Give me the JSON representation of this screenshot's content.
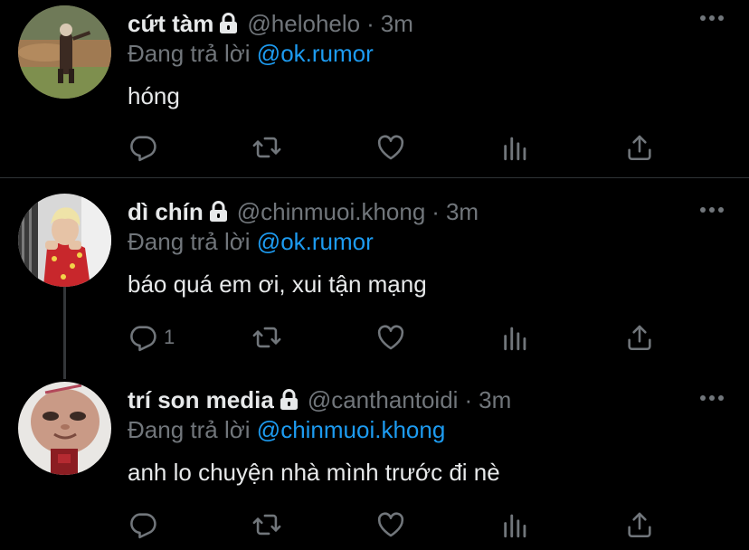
{
  "reply_prefix": "Đang trả lời",
  "colors": {
    "background": "#000000",
    "text": "#e7e9ea",
    "secondary": "#71767b",
    "mention": "#1d9bf0",
    "divider": "#2f3336"
  },
  "tweets": [
    {
      "display_name": "cứt tàm",
      "handle": "@helohelo",
      "separator": "·",
      "time": "3m",
      "locked": true,
      "replying_to": "@ok.rumor",
      "text": "hóng",
      "avatar": "person-in-coat-outdoors-photo",
      "reply_count": "",
      "actions": [
        "reply-icon",
        "retweet-icon",
        "like-icon",
        "analytics-icon",
        "share-icon"
      ]
    },
    {
      "display_name": "dì chín",
      "handle": "@chinmuoi.khong",
      "separator": "·",
      "time": "3m",
      "locked": true,
      "replying_to": "@ok.rumor",
      "text": "báo quá em ơi, xui tận mạng",
      "avatar": "blonde-person-red-shirt-photo",
      "reply_count": "1",
      "actions": [
        "reply-icon",
        "retweet-icon",
        "like-icon",
        "analytics-icon",
        "share-icon"
      ]
    },
    {
      "display_name": "trí son media",
      "handle": "@canthantoidi",
      "separator": "·",
      "time": "3m",
      "locked": true,
      "replying_to": "@chinmuoi.khong",
      "text": "anh lo chuyện nhà mình trước đi nè",
      "avatar": "close-up-face-figure-photo",
      "reply_count": "",
      "actions": [
        "reply-icon",
        "retweet-icon",
        "like-icon",
        "analytics-icon",
        "share-icon"
      ]
    }
  ]
}
